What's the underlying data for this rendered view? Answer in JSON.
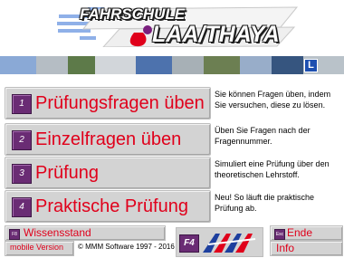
{
  "header": {
    "logo_line1": "FAHRSCHULE",
    "logo_line2": "LAA/THAYA",
    "photo_badge": "L"
  },
  "menu": [
    {
      "key": "1",
      "label": "Prüfungsfragen üben",
      "description": "Sie können Fragen üben, indem Sie versuchen, diese zu lösen."
    },
    {
      "key": "2",
      "label": "Einzelfragen üben",
      "description": "Üben Sie Fragen nach der Fragennummer."
    },
    {
      "key": "3",
      "label": "Prüfung",
      "description": "Simuliert eine Prüfung über den theoretischen Lehrstoff."
    },
    {
      "key": "4",
      "label": "Praktische Prüfung",
      "description": "Neu! So läuft die praktische Prüfung ab."
    }
  ],
  "bottom": {
    "knowledge_key": "F8",
    "knowledge_label": "Wissensstand",
    "mobile_label": "mobile Version",
    "copyright": "© MMM Software 1997 - 2016",
    "f4_key": "F4",
    "end_key": "Esc",
    "end_label": "Ende",
    "info_label": "Info"
  },
  "colors": {
    "accent_red": "#e0001b",
    "number_box": "#6a2c74",
    "button_gray": "#d3d3d3"
  }
}
